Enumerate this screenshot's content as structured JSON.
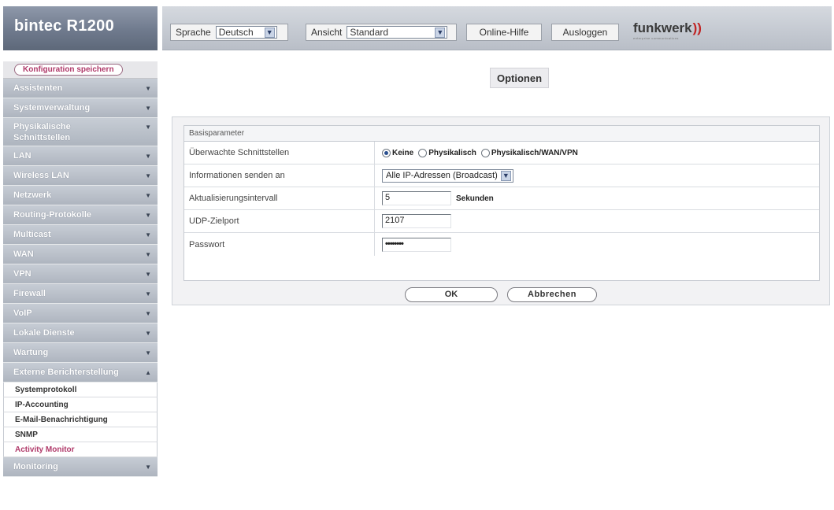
{
  "header": {
    "brand": "bintec R1200",
    "language_label": "Sprache",
    "language_value": "Deutsch",
    "view_label": "Ansicht",
    "view_value": "Standard",
    "help_label": "Online-Hilfe",
    "logout_label": "Ausloggen",
    "logo_text": "funkwerk",
    "logo_tagline": "enterprise communications"
  },
  "sidebar": {
    "save_label": "Konfiguration speichern",
    "items": [
      {
        "label": "Assistenten"
      },
      {
        "label": "Systemverwaltung"
      },
      {
        "label": "Physikalische Schnittstellen"
      },
      {
        "label": "LAN"
      },
      {
        "label": "Wireless LAN"
      },
      {
        "label": "Netzwerk"
      },
      {
        "label": "Routing-Protokolle"
      },
      {
        "label": "Multicast"
      },
      {
        "label": "WAN"
      },
      {
        "label": "VPN"
      },
      {
        "label": "Firewall"
      },
      {
        "label": "VoIP"
      },
      {
        "label": "Lokale Dienste"
      },
      {
        "label": "Wartung"
      },
      {
        "label": "Externe Berichterstellung"
      }
    ],
    "sub_items": [
      {
        "label": "Systemprotokoll"
      },
      {
        "label": "IP-Accounting"
      },
      {
        "label": "E-Mail-Benachrichtigung"
      },
      {
        "label": "SNMP"
      },
      {
        "label": "Activity Monitor"
      }
    ],
    "last_item": {
      "label": "Monitoring"
    }
  },
  "main": {
    "page_title": "Optionen",
    "section_title": "Basisparameter",
    "rows": [
      {
        "label": "Überwachte Schnittstellen",
        "options": [
          "Keine",
          "Physikalisch",
          "Physikalisch/WAN/VPN"
        ],
        "selected": "Keine"
      },
      {
        "label": "Informationen senden an",
        "value": "Alle IP-Adressen (Broadcast)"
      },
      {
        "label": "Aktualisierungsintervall",
        "value": "5",
        "unit": "Sekunden"
      },
      {
        "label": "UDP-Zielport",
        "value": "2107"
      },
      {
        "label": "Passwort",
        "value": "••••••••"
      }
    ],
    "ok_label": "OK",
    "cancel_label": "Abbrechen"
  },
  "colors": {
    "sidebar_bg": "#aeb5bf",
    "accent": "#b03a6a",
    "header_bg": "#c4c9d1"
  }
}
